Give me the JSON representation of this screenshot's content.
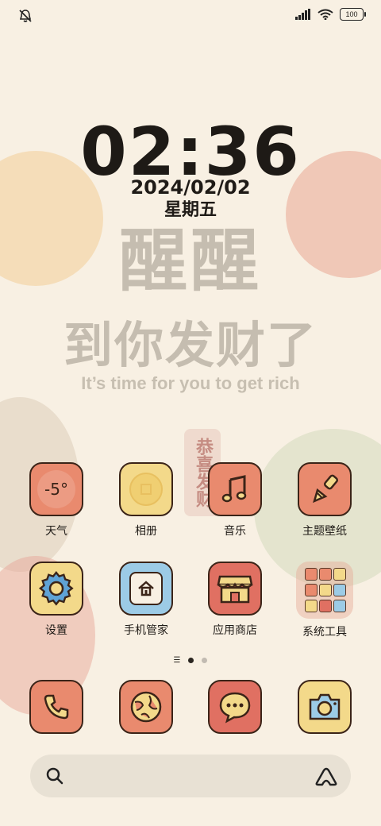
{
  "status_bar": {
    "battery": "100"
  },
  "lock": {
    "time": "02:36",
    "date": "2024/02/02",
    "weekday": "星期五"
  },
  "wallpaper": {
    "line1": "醒醒",
    "line2": "到你发财了",
    "line3": "It’s time for you to get rich",
    "stamp": "恭喜发财"
  },
  "apps": [
    {
      "label": "天气",
      "icon_text": "-5°",
      "icon": "weather-icon",
      "color": "#e98a6e"
    },
    {
      "label": "相册",
      "icon": "gallery-icon",
      "color": "#f3d98a"
    },
    {
      "label": "音乐",
      "icon": "music-note-icon",
      "color": "#e98a6e"
    },
    {
      "label": "主题壁纸",
      "icon": "paintbrush-icon",
      "color": "#e98a6e"
    },
    {
      "label": "设置",
      "icon": "gear-icon",
      "color": "#f3d98a"
    },
    {
      "label": "手机管家",
      "icon": "home-security-icon",
      "color": "#9ccbe6"
    },
    {
      "label": "应用商店",
      "icon": "store-icon",
      "color": "#e07062"
    },
    {
      "label": "系统工具",
      "icon": "folder-icon",
      "color": "#f0b8a4"
    }
  ],
  "dock": [
    {
      "name": "phone-icon",
      "color": "#e98a6e"
    },
    {
      "name": "browser-globe-icon",
      "color": "#e98a6e"
    },
    {
      "name": "messages-icon",
      "color": "#e07062"
    },
    {
      "name": "camera-icon",
      "color": "#f3d98a"
    }
  ],
  "page_indicator": {
    "pages": 2,
    "active": 0
  }
}
